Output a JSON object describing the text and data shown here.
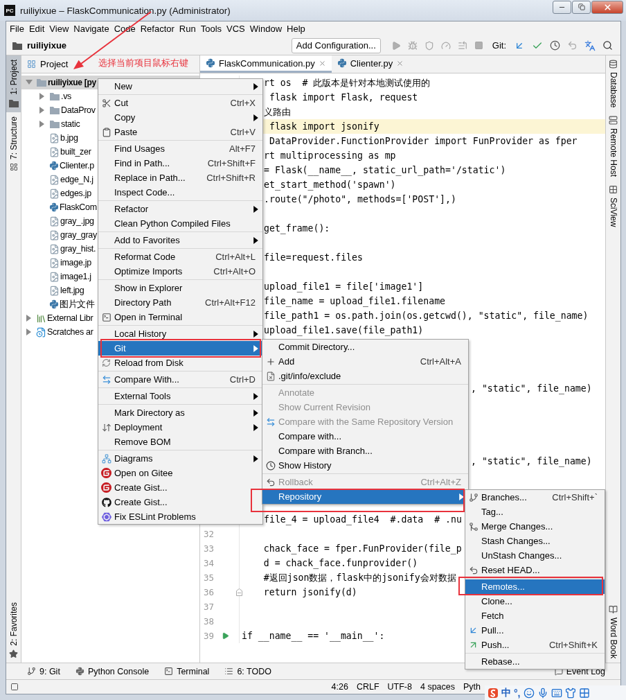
{
  "window": {
    "app_badge": "PC",
    "title": "ruiliyixue – FlaskCommunication.py (Administrator)"
  },
  "menu_bar": [
    "File",
    "Edit",
    "View",
    "Navigate",
    "Code",
    "Refactor",
    "Run",
    "Tools",
    "VCS",
    "Window",
    "Help"
  ],
  "nav_bar": {
    "project": "ruiliyixue",
    "run_config": "Add Configuration...",
    "git_label": "Git:"
  },
  "annotation": {
    "text": "选择当前项目鼠标右键"
  },
  "left_strip": [
    {
      "label": "1: Project",
      "kind": "folder",
      "selected": true
    },
    {
      "label": "7: Structure",
      "kind": "structure",
      "selected": false
    }
  ],
  "left_strip_bottom": [
    {
      "label": "2: Favorites",
      "kind": "star",
      "selected": false
    }
  ],
  "project_panel": {
    "title": "Project",
    "tree": [
      {
        "label": "ruiliyixue [py",
        "kind": "folder",
        "expanded": true,
        "selected": true,
        "children": [
          {
            "label": ".vs",
            "kind": "folder",
            "expanded": false,
            "selected": false
          },
          {
            "label": "DataProv",
            "kind": "folder",
            "expanded": false,
            "selected": false
          },
          {
            "label": "static",
            "kind": "folder",
            "expanded": false,
            "selected": false
          },
          {
            "label": "b.jpg",
            "kind": "image",
            "selected": false
          },
          {
            "label": "built_zer",
            "kind": "image",
            "selected": false
          },
          {
            "label": "Clienter.p",
            "kind": "python",
            "selected": false
          },
          {
            "label": "edge_N.j",
            "kind": "image",
            "selected": false
          },
          {
            "label": "edges.jp",
            "kind": "image",
            "selected": false
          },
          {
            "label": "FlaskCom",
            "kind": "python",
            "selected": false
          },
          {
            "label": "gray_.jpg",
            "kind": "image",
            "selected": false
          },
          {
            "label": "gray_gray",
            "kind": "image",
            "selected": false
          },
          {
            "label": "gray_hist.",
            "kind": "image",
            "selected": false
          },
          {
            "label": "image.jp",
            "kind": "image",
            "selected": false
          },
          {
            "label": "image1.j",
            "kind": "image",
            "selected": false
          },
          {
            "label": "left.jpg",
            "kind": "image",
            "selected": false
          },
          {
            "label": "图片文件",
            "kind": "python",
            "selected": false
          }
        ]
      },
      {
        "label": "External Libr",
        "kind": "library",
        "expanded": false,
        "selected": false
      },
      {
        "label": "Scratches ar",
        "kind": "scratches",
        "expanded": false,
        "selected": false
      }
    ]
  },
  "editor_tabs": [
    {
      "label": "FlaskCommunication.py",
      "selected": true
    },
    {
      "label": "Clienter.py",
      "selected": false
    }
  ],
  "editor": {
    "lines": [
      {
        "kind": "covered",
        "current": false,
        "text": "rt os  # 此版本是针对本地测试使用的"
      },
      {
        "kind": "covered",
        "current": false,
        "text": " flask import Flask, request"
      },
      {
        "kind": "covered",
        "current": false,
        "text": "义路由"
      },
      {
        "kind": "covered",
        "current": true,
        "text": " flask import jsonify"
      },
      {
        "kind": "covered",
        "current": false,
        "text": " DataProvider.FunctionProvider import FunProvider as fper"
      },
      {
        "kind": "covered",
        "current": false,
        "text": "rt multiprocessing as mp"
      },
      {
        "kind": "covered",
        "current": false,
        "text": "= Flask(__name__, static_url_path='/static')"
      },
      {
        "kind": "covered",
        "current": false,
        "text": "et_start_method('spawn')"
      },
      {
        "kind": "covered",
        "current": false,
        "text": ".route(\"/photo\", methods=['POST'],)"
      },
      {
        "kind": "covered",
        "current": false
      },
      {
        "kind": "covered",
        "current": false,
        "text": "get_frame():"
      },
      {
        "kind": "covered",
        "current": false
      },
      {
        "kind": "covered",
        "current": false,
        "text": "file=request.files"
      },
      {
        "kind": "covered",
        "current": false
      },
      {
        "kind": "covered",
        "current": false,
        "text": "upload_file1 = file['image1']"
      },
      {
        "kind": "covered",
        "current": false,
        "text": "file_name = upload_file1.filename"
      },
      {
        "kind": "covered",
        "current": false,
        "text": "file_path1 = os.path.join(os.getcwd(), \"static\", file_name)"
      },
      {
        "kind": "covered",
        "current": false,
        "text": "upload_file1.save(file_path1)"
      },
      {
        "kind": "covered",
        "current": false
      },
      {
        "kind": "covered",
        "current": false
      },
      {
        "kind": "covered",
        "current": false
      },
      {
        "kind": "tail",
        "current": false,
        "text": ", \"static\", file_name)"
      },
      {
        "kind": "covered",
        "current": false
      },
      {
        "kind": "covered",
        "current": false
      },
      {
        "kind": "covered",
        "current": false
      },
      {
        "kind": "covered",
        "current": false
      },
      {
        "kind": "tail",
        "current": false,
        "text": ", \"static\", file_name)"
      },
      {
        "kind": "covered",
        "current": false
      },
      {
        "kind": "covered",
        "current": false
      },
      {
        "kind": "covered",
        "current": false
      },
      {
        "kind": "covered",
        "current": false,
        "text": "file_4 = upload_file4  #.data  # .nu"
      },
      {
        "kind": "numbered",
        "current": false,
        "number": "32"
      },
      {
        "kind": "numbered",
        "current": false,
        "number": "33",
        "text": "    chack_face = fper.FunProvider(file_p"
      },
      {
        "kind": "numbered",
        "current": false,
        "number": "34",
        "text": "    d = chack_face.funprovider()"
      },
      {
        "kind": "numbered",
        "current": false,
        "number": "35",
        "text": "    #返回json数据，flask中的jsonify会对数据"
      },
      {
        "kind": "numbered",
        "current": false,
        "number": "36",
        "text": "    return jsonify(d)",
        "fold_marker": true
      },
      {
        "kind": "numbered",
        "current": false,
        "number": "37"
      },
      {
        "kind": "numbered",
        "current": false,
        "number": "38"
      },
      {
        "kind": "numbered",
        "current": false,
        "number": "39",
        "text": "if __name__ == '__main__':",
        "run_marker": true
      }
    ]
  },
  "right_strip": [
    {
      "label": "Database",
      "kind": "database"
    },
    {
      "label": "Remote Host",
      "kind": "server"
    },
    {
      "label": "SciView",
      "kind": "grid"
    }
  ],
  "right_strip_bottom": [
    {
      "label": "Word Book",
      "kind": "book"
    }
  ],
  "tool_windows": [
    {
      "label": "9: Git",
      "kind": "git"
    },
    {
      "label": "Python Console",
      "kind": "python"
    },
    {
      "label": "Terminal",
      "kind": "terminal"
    },
    {
      "label": "6: TODO",
      "kind": "list"
    }
  ],
  "event_log": "Event Log",
  "status_bar": [
    "4:26",
    "CRLF",
    "UTF-8",
    "4 spaces",
    "Pyth"
  ],
  "ime_bar": {
    "mode": "中",
    "punctuation": "°,"
  },
  "context_menu": {
    "groups": [
      [
        {
          "label": "New",
          "kind": "plain",
          "submenu": true,
          "selected": false
        }
      ],
      [
        {
          "label": "Cut",
          "shortcut": "Ctrl+X",
          "kind": "scissors",
          "submenu": false,
          "selected": false
        },
        {
          "label": "Copy",
          "kind": "plain",
          "submenu": true,
          "selected": false
        },
        {
          "label": "Paste",
          "shortcut": "Ctrl+V",
          "kind": "clipboard",
          "submenu": false,
          "selected": false
        }
      ],
      [
        {
          "label": "Find Usages",
          "shortcut": "Alt+F7",
          "kind": "plain",
          "submenu": false,
          "selected": false
        },
        {
          "label": "Find in Path...",
          "shortcut": "Ctrl+Shift+F",
          "kind": "plain",
          "submenu": false,
          "selected": false
        },
        {
          "label": "Replace in Path...",
          "shortcut": "Ctrl+Shift+R",
          "kind": "plain",
          "submenu": false,
          "selected": false
        },
        {
          "label": "Inspect Code...",
          "kind": "plain",
          "submenu": false,
          "selected": false
        }
      ],
      [
        {
          "label": "Refactor",
          "kind": "plain",
          "submenu": true,
          "selected": false
        },
        {
          "label": "Clean Python Compiled Files",
          "kind": "plain",
          "submenu": false,
          "selected": false
        }
      ],
      [
        {
          "label": "Add to Favorites",
          "kind": "plain",
          "submenu": true,
          "selected": false
        }
      ],
      [
        {
          "label": "Reformat Code",
          "shortcut": "Ctrl+Alt+L",
          "kind": "plain",
          "submenu": false,
          "selected": false
        },
        {
          "label": "Optimize Imports",
          "shortcut": "Ctrl+Alt+O",
          "kind": "plain",
          "submenu": false,
          "selected": false
        }
      ],
      [
        {
          "label": "Show in Explorer",
          "kind": "plain",
          "submenu": false,
          "selected": false
        },
        {
          "label": "Directory Path",
          "shortcut": "Ctrl+Alt+F12",
          "kind": "plain",
          "submenu": false,
          "selected": false
        },
        {
          "label": "Open in Terminal",
          "kind": "terminal",
          "submenu": false,
          "selected": false
        }
      ],
      [
        {
          "label": "Local History",
          "kind": "plain",
          "submenu": true,
          "selected": false
        },
        {
          "label": "Git",
          "kind": "plain",
          "submenu": true,
          "selected": true
        },
        {
          "label": "Reload from Disk",
          "kind": "reload",
          "submenu": false,
          "selected": false
        }
      ],
      [
        {
          "label": "Compare With...",
          "shortcut": "Ctrl+D",
          "kind": "compare",
          "submenu": false,
          "selected": false
        }
      ],
      [
        {
          "label": "External Tools",
          "kind": "plain",
          "submenu": true,
          "selected": false
        }
      ],
      [
        {
          "label": "Mark Directory as",
          "kind": "plain",
          "submenu": true,
          "selected": false
        },
        {
          "label": "Deployment",
          "kind": "deployment",
          "submenu": true,
          "selected": false
        },
        {
          "label": "Remove BOM",
          "kind": "plain",
          "submenu": false,
          "selected": false
        }
      ],
      [
        {
          "label": "Diagrams",
          "kind": "diagrams",
          "submenu": true,
          "selected": false
        },
        {
          "label": "Open on Gitee",
          "kind": "gitee",
          "submenu": false,
          "selected": false
        },
        {
          "label": "Create Gist...",
          "kind": "gitee",
          "submenu": false,
          "selected": false
        },
        {
          "label": "Create Gist...",
          "kind": "github",
          "submenu": false,
          "selected": false
        },
        {
          "label": "Fix ESLint Problems",
          "kind": "eslint",
          "submenu": false,
          "selected": false
        }
      ]
    ]
  },
  "git_menu": {
    "groups": [
      [
        {
          "label": "Commit Directory...",
          "kind": "plain",
          "submenu": false,
          "selected": false,
          "disabled": false
        },
        {
          "label": "Add",
          "shortcut": "Ctrl+Alt+A",
          "kind": "plus",
          "submenu": false,
          "selected": false,
          "disabled": false
        },
        {
          "label": ".git/info/exclude",
          "kind": "exclude",
          "submenu": false,
          "selected": false,
          "disabled": false
        }
      ],
      [
        {
          "label": "Annotate",
          "kind": "plain",
          "submenu": false,
          "selected": false,
          "disabled": true
        },
        {
          "label": "Show Current Revision",
          "kind": "plain",
          "submenu": false,
          "selected": false,
          "disabled": true
        },
        {
          "label": "Compare with the Same Repository Version",
          "kind": "compare",
          "submenu": false,
          "selected": false,
          "disabled": true
        },
        {
          "label": "Compare with...",
          "kind": "plain",
          "submenu": false,
          "selected": false,
          "disabled": false
        },
        {
          "label": "Compare with Branch...",
          "kind": "plain",
          "submenu": false,
          "selected": false,
          "disabled": false
        },
        {
          "label": "Show History",
          "kind": "clock",
          "submenu": false,
          "selected": false,
          "disabled": false
        }
      ],
      [
        {
          "label": "Rollback",
          "shortcut": "Ctrl+Alt+Z",
          "kind": "undo",
          "submenu": false,
          "selected": false,
          "disabled": true
        },
        {
          "label": "Repository",
          "kind": "plain",
          "submenu": true,
          "selected": true,
          "disabled": false
        }
      ]
    ]
  },
  "repository_menu": {
    "groups": [
      [
        {
          "label": "Branches...",
          "shortcut": "Ctrl+Shift+`",
          "kind": "branch",
          "submenu": false,
          "selected": false
        },
        {
          "label": "Tag...",
          "kind": "plain",
          "submenu": false,
          "selected": false
        },
        {
          "label": "Merge Changes...",
          "kind": "merge",
          "submenu": false,
          "selected": false
        },
        {
          "label": "Stash Changes...",
          "kind": "plain",
          "submenu": false,
          "selected": false
        },
        {
          "label": "UnStash Changes...",
          "kind": "plain",
          "submenu": false,
          "selected": false
        },
        {
          "label": "Reset HEAD...",
          "kind": "undo",
          "submenu": false,
          "selected": false
        }
      ],
      [
        {
          "label": "Remotes...",
          "kind": "plain",
          "submenu": false,
          "selected": true
        },
        {
          "label": "Clone...",
          "kind": "plain",
          "submenu": false,
          "selected": false
        },
        {
          "label": "Fetch",
          "kind": "plain",
          "submenu": false,
          "selected": false
        },
        {
          "label": "Pull...",
          "kind": "pull",
          "submenu": false,
          "selected": false
        },
        {
          "label": "Push...",
          "shortcut": "Ctrl+Shift+K",
          "kind": "push",
          "submenu": false,
          "selected": false
        }
      ],
      [
        {
          "label": "Rebase...",
          "kind": "plain",
          "submenu": false,
          "selected": false
        }
      ]
    ]
  }
}
